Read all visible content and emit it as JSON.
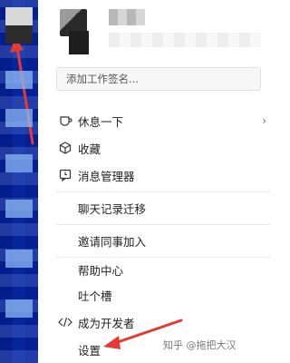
{
  "signature": {
    "placeholder": "添加工作签名..."
  },
  "menu": {
    "rest": "休息一下",
    "favorites": "收藏",
    "message_manager": "消息管理器",
    "chat_migrate": "聊天记录迁移",
    "invite": "邀请同事加入",
    "help": "帮助中心",
    "feedback": "吐个槽",
    "developer": "成为开发者",
    "settings": "设置"
  },
  "watermark": "知乎 @拖把大汉",
  "colors": {
    "sidebar": "#3f82d8",
    "annotation_arrow": "#e53935"
  }
}
